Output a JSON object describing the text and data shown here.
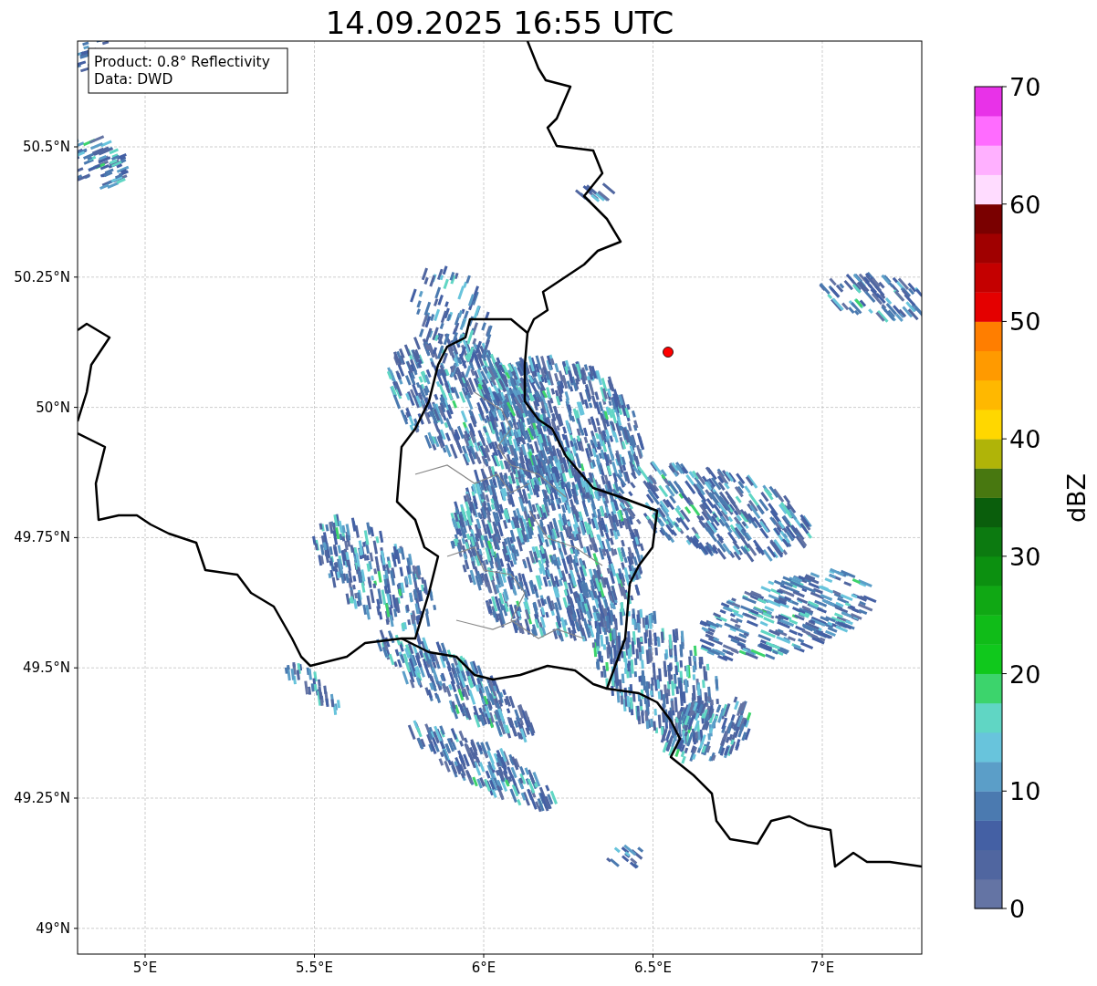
{
  "title": "14.09.2025 16:55 UTC",
  "legend": {
    "lines": [
      "Product: 0.8° Reflectivity",
      "Data: DWD"
    ]
  },
  "map": {
    "x_ticks": [
      "5°E",
      "5.5°E",
      "6°E",
      "6.5°E",
      "7°E"
    ],
    "y_ticks": [
      "50.5°N",
      "50.25°N",
      "50°N",
      "49.75°N",
      "49.5°N",
      "49.25°N",
      "49°N"
    ]
  },
  "colorbar": {
    "label": "dBZ",
    "ticks": [
      "70",
      "60",
      "50",
      "40",
      "30",
      "20",
      "10",
      "0"
    ],
    "segments": [
      {
        "color": "#6474a4"
      },
      {
        "color": "#5066a0"
      },
      {
        "color": "#4460a4"
      },
      {
        "color": "#4b7ab0"
      },
      {
        "color": "#5b9ec8"
      },
      {
        "color": "#68c4dc"
      },
      {
        "color": "#60d6c4"
      },
      {
        "color": "#3cd46c"
      },
      {
        "color": "#10c81c"
      },
      {
        "color": "#10bc18"
      },
      {
        "color": "#10a814"
      },
      {
        "color": "#0c9010"
      },
      {
        "color": "#0c7a10"
      },
      {
        "color": "#0a5e0c"
      },
      {
        "color": "#487810"
      },
      {
        "color": "#b0b408"
      },
      {
        "color": "#ffd700"
      },
      {
        "color": "#ffb800"
      },
      {
        "color": "#ff9a00"
      },
      {
        "color": "#ff7e00"
      },
      {
        "color": "#e40000"
      },
      {
        "color": "#c40000"
      },
      {
        "color": "#a00000"
      },
      {
        "color": "#7a0000"
      },
      {
        "color": "#ffdcff"
      },
      {
        "color": "#ffb0ff"
      },
      {
        "color": "#ff6cff"
      },
      {
        "color": "#e832e8"
      }
    ]
  }
}
